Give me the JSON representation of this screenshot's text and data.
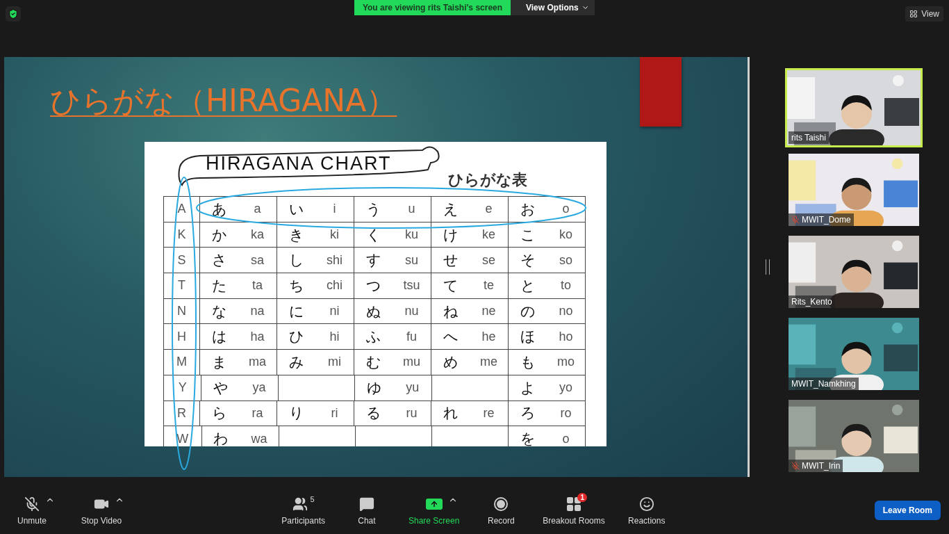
{
  "top_bar": {
    "banner": "You are viewing rits Taishi's screen",
    "view_options": "View Options",
    "view": "View"
  },
  "slide": {
    "title": "ひらがな（HIRAGANA）",
    "chart_title": "HIRAGANA CHART",
    "chart_subtitle": "ひらがな表",
    "rows": [
      {
        "consonant": "A",
        "cells": [
          {
            "kana": "あ",
            "romaji": "a"
          },
          {
            "kana": "い",
            "romaji": "i"
          },
          {
            "kana": "う",
            "romaji": "u"
          },
          {
            "kana": "え",
            "romaji": "e"
          },
          {
            "kana": "お",
            "romaji": "o"
          }
        ]
      },
      {
        "consonant": "K",
        "cells": [
          {
            "kana": "か",
            "romaji": "ka"
          },
          {
            "kana": "き",
            "romaji": "ki"
          },
          {
            "kana": "く",
            "romaji": "ku"
          },
          {
            "kana": "け",
            "romaji": "ke"
          },
          {
            "kana": "こ",
            "romaji": "ko"
          }
        ]
      },
      {
        "consonant": "S",
        "cells": [
          {
            "kana": "さ",
            "romaji": "sa"
          },
          {
            "kana": "し",
            "romaji": "shi"
          },
          {
            "kana": "す",
            "romaji": "su"
          },
          {
            "kana": "せ",
            "romaji": "se"
          },
          {
            "kana": "そ",
            "romaji": "so"
          }
        ]
      },
      {
        "consonant": "T",
        "cells": [
          {
            "kana": "た",
            "romaji": "ta"
          },
          {
            "kana": "ち",
            "romaji": "chi"
          },
          {
            "kana": "つ",
            "romaji": "tsu"
          },
          {
            "kana": "て",
            "romaji": "te"
          },
          {
            "kana": "と",
            "romaji": "to"
          }
        ]
      },
      {
        "consonant": "N",
        "cells": [
          {
            "kana": "な",
            "romaji": "na"
          },
          {
            "kana": "に",
            "romaji": "ni"
          },
          {
            "kana": "ぬ",
            "romaji": "nu"
          },
          {
            "kana": "ね",
            "romaji": "ne"
          },
          {
            "kana": "の",
            "romaji": "no"
          }
        ]
      },
      {
        "consonant": "H",
        "cells": [
          {
            "kana": "は",
            "romaji": "ha"
          },
          {
            "kana": "ひ",
            "romaji": "hi"
          },
          {
            "kana": "ふ",
            "romaji": "fu"
          },
          {
            "kana": "へ",
            "romaji": "he"
          },
          {
            "kana": "ほ",
            "romaji": "ho"
          }
        ]
      },
      {
        "consonant": "M",
        "cells": [
          {
            "kana": "ま",
            "romaji": "ma"
          },
          {
            "kana": "み",
            "romaji": "mi"
          },
          {
            "kana": "む",
            "romaji": "mu"
          },
          {
            "kana": "め",
            "romaji": "me"
          },
          {
            "kana": "も",
            "romaji": "mo"
          }
        ]
      },
      {
        "consonant": "Y",
        "cells": [
          {
            "kana": "や",
            "romaji": "ya"
          },
          {
            "kind": "blank"
          },
          {
            "kana": "ゆ",
            "romaji": "yu"
          },
          {
            "kind": "blank"
          },
          {
            "kana": "よ",
            "romaji": "yo"
          }
        ]
      },
      {
        "consonant": "R",
        "cells": [
          {
            "kana": "ら",
            "romaji": "ra"
          },
          {
            "kana": "り",
            "romaji": "ri"
          },
          {
            "kana": "る",
            "romaji": "ru"
          },
          {
            "kana": "れ",
            "romaji": "re"
          },
          {
            "kana": "ろ",
            "romaji": "ro"
          }
        ]
      },
      {
        "consonant": "W",
        "cells": [
          {
            "kana": "わ",
            "romaji": "wa"
          },
          {
            "kind": "blank"
          },
          {
            "kind": "blank"
          },
          {
            "kind": "blank"
          },
          {
            "kana": "を",
            "romaji": "o"
          }
        ]
      }
    ]
  },
  "participants": [
    {
      "name": "rits Taishi",
      "muted": false,
      "speaking": true,
      "kind": "picture"
    },
    {
      "name": "MWIT_Dome",
      "muted": true,
      "speaking": false,
      "kind": "picture"
    },
    {
      "name": "Rits_Kento",
      "muted": false,
      "speaking": false,
      "kind": "picture"
    },
    {
      "name": "MWIT_Namkhing",
      "muted": false,
      "speaking": false,
      "kind": "picture"
    },
    {
      "name": "MWIT_Irin",
      "muted": true,
      "speaking": false,
      "kind": "picture"
    }
  ],
  "toolbar": {
    "left": [
      {
        "kind": "mic",
        "label": "Unmute",
        "caret": true
      },
      {
        "kind": "video",
        "label": "Stop Video",
        "caret": true
      }
    ],
    "center": [
      {
        "kind": "participants",
        "label": "Participants",
        "count": "5",
        "caret": false
      },
      {
        "kind": "chat",
        "label": "Chat",
        "caret": false
      },
      {
        "kind": "share",
        "label": "Share Screen",
        "caret": true
      },
      {
        "kind": "record",
        "label": "Record",
        "caret": false
      },
      {
        "kind": "breakout",
        "label": "Breakout Rooms",
        "badge": "1",
        "caret": false
      },
      {
        "kind": "reactions",
        "label": "Reactions",
        "caret": false
      }
    ],
    "leave": "Leave Room"
  }
}
